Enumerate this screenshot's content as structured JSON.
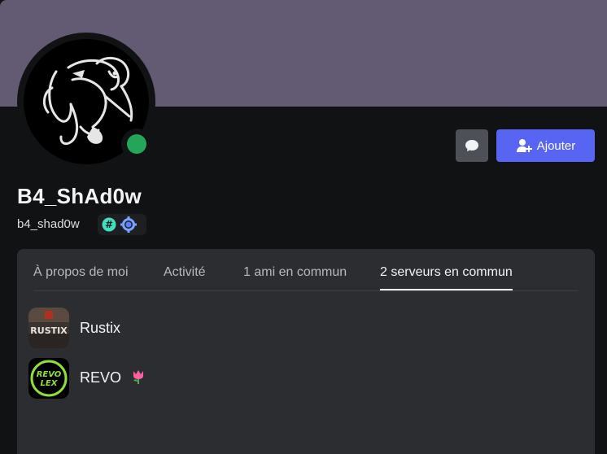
{
  "profile": {
    "display_name": "B4_ShAd0w",
    "username": "b4_shad0w",
    "status": "online",
    "banner_color": "#625b73",
    "status_color": "#23a55a",
    "accent_color": "#5865f2"
  },
  "actions": {
    "message_icon": "chat-bubble-icon",
    "add_label": "Ajouter",
    "add_icon": "add-friend-icon"
  },
  "badges": [
    {
      "icon": "hypesquad-hash-icon"
    },
    {
      "icon": "nitro-gear-icon"
    }
  ],
  "tabs": [
    {
      "label": "À propos de moi",
      "active": false
    },
    {
      "label": "Activité",
      "active": false
    },
    {
      "label": "1 ami en commun",
      "active": false
    },
    {
      "label": "2 serveurs en commun",
      "active": true
    }
  ],
  "servers": [
    {
      "name": "Rustix",
      "icon_text": "RUSTIX",
      "emoji": ""
    },
    {
      "name": "REVO",
      "icon_text_top": "REVO",
      "icon_text_bottom": "LEX",
      "emoji": "🌷"
    }
  ]
}
